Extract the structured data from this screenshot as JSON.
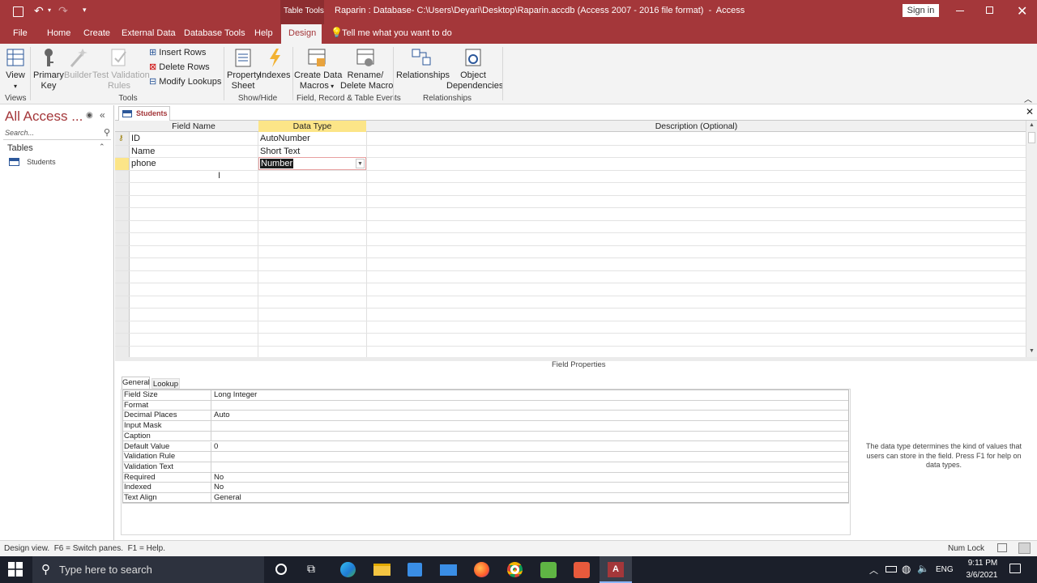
{
  "title_bar": {
    "context_label": "Table Tools",
    "title": "Raparin : Database- C:\\Users\\Deyari\\Desktop\\Raparin.accdb (Access 2007 - 2016 file format)  -  Access",
    "sign_in": "Sign in"
  },
  "tabs": [
    "File",
    "Home",
    "Create",
    "External Data",
    "Database Tools",
    "Help",
    "Design"
  ],
  "tell_me": "Tell me what you want to do",
  "ribbon": {
    "view": "View",
    "primary_key": [
      "Primary",
      "Key"
    ],
    "builder": "Builder",
    "test_validation": [
      "Test Validation",
      "Rules"
    ],
    "insert_rows": "Insert Rows",
    "delete_rows": "Delete Rows",
    "modify_lookups": "Modify Lookups",
    "property_sheet": [
      "Property",
      "Sheet"
    ],
    "indexes": "Indexes",
    "create_data_macros": [
      "Create Data",
      "Macros"
    ],
    "rename_delete_macro": [
      "Rename/",
      "Delete Macro"
    ],
    "relationships": "Relationships",
    "object_dependencies": [
      "Object",
      "Dependencies"
    ],
    "groups": [
      "Views",
      "Tools",
      "Show/Hide",
      "Field, Record & Table Events",
      "Relationships"
    ]
  },
  "nav": {
    "title": "All Access ...",
    "search_placeholder": "Search...",
    "section": "Tables",
    "items": [
      "Students"
    ]
  },
  "document_tab": "Students",
  "design_grid": {
    "headers": [
      "Field Name",
      "Data Type",
      "Description (Optional)"
    ],
    "rows": [
      {
        "name": "ID",
        "type": "AutoNumber",
        "description": ""
      },
      {
        "name": "Name",
        "type": "Short Text",
        "description": ""
      },
      {
        "name": "phone",
        "type": "Number",
        "description": ""
      }
    ]
  },
  "field_properties": {
    "title": "Field Properties",
    "tabs": [
      "General",
      "Lookup"
    ],
    "rows": [
      {
        "label": "Field Size",
        "value": "Long Integer"
      },
      {
        "label": "Format",
        "value": ""
      },
      {
        "label": "Decimal Places",
        "value": "Auto"
      },
      {
        "label": "Input Mask",
        "value": ""
      },
      {
        "label": "Caption",
        "value": ""
      },
      {
        "label": "Default Value",
        "value": "0"
      },
      {
        "label": "Validation Rule",
        "value": ""
      },
      {
        "label": "Validation Text",
        "value": ""
      },
      {
        "label": "Required",
        "value": "No"
      },
      {
        "label": "Indexed",
        "value": "No"
      },
      {
        "label": "Text Align",
        "value": "General"
      }
    ],
    "help_text": "The data type determines the kind of values that users can store in the field. Press F1 for help on data types."
  },
  "status": {
    "left": "Design view.  F6 = Switch panes.  F1 = Help.",
    "num_lock": "Num Lock"
  },
  "taskbar": {
    "search_placeholder": "Type here to search",
    "language": "ENG",
    "time": "9:11 PM",
    "date": "3/6/2021"
  },
  "colors": {
    "accent": "#a4373a",
    "selected_header": "#fce588",
    "taskbar": "#1b1f2a"
  }
}
